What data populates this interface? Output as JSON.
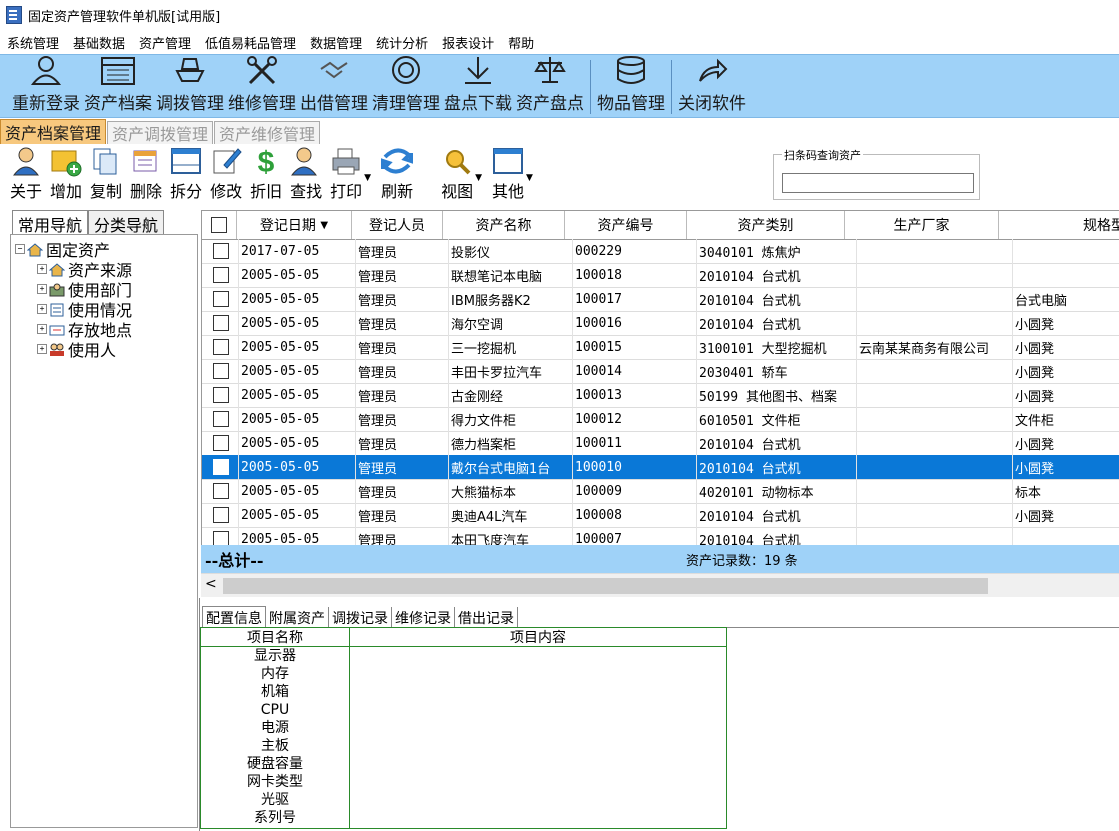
{
  "window": {
    "title": "固定资产管理软件单机版[试用版]"
  },
  "menu": [
    "系统管理",
    "基础数据",
    "资产管理",
    "低值易耗品管理",
    "数据管理",
    "统计分析",
    "报表设计",
    "帮助"
  ],
  "ribbon": [
    {
      "label": "重新登录",
      "icon": "user-icon"
    },
    {
      "label": "资产档案",
      "icon": "table-icon"
    },
    {
      "label": "调拨管理",
      "icon": "ship-icon"
    },
    {
      "label": "维修管理",
      "icon": "tools-icon"
    },
    {
      "label": "出借管理",
      "icon": "handshake-icon"
    },
    {
      "label": "清理管理",
      "icon": "clean-icon"
    },
    {
      "label": "盘点下载",
      "icon": "download-icon"
    },
    {
      "label": "资产盘点",
      "icon": "scale-icon"
    },
    {
      "label": "物品管理",
      "icon": "database-icon"
    },
    {
      "label": "关闭软件",
      "icon": "share-icon"
    }
  ],
  "module_tabs": [
    {
      "label": "资产档案管理",
      "active": true
    },
    {
      "label": "资产调拨管理",
      "active": false
    },
    {
      "label": "资产维修管理",
      "active": false
    }
  ],
  "toolbar": [
    {
      "label": "关于",
      "icon": "person-icon"
    },
    {
      "label": "增加",
      "icon": "add-folder-icon"
    },
    {
      "label": "复制",
      "icon": "copy-icon"
    },
    {
      "label": "删除",
      "icon": "delete-icon"
    },
    {
      "label": "拆分",
      "icon": "split-icon"
    },
    {
      "label": "修改",
      "icon": "edit-icon"
    },
    {
      "label": "折旧",
      "icon": "dollar-icon"
    },
    {
      "label": "查找",
      "icon": "find-person-icon"
    },
    {
      "label": "打印",
      "icon": "printer-icon"
    },
    {
      "label": "刷新",
      "icon": "refresh-icon"
    },
    {
      "label": "视图",
      "icon": "view-icon"
    },
    {
      "label": "其他",
      "icon": "other-icon"
    }
  ],
  "scan": {
    "legend": "扫条码查询资产",
    "value": ""
  },
  "nav_tabs": [
    "常用导航",
    "分类导航"
  ],
  "tree": {
    "root": "固定资产",
    "children": [
      "资产来源",
      "使用部门",
      "使用情况",
      "存放地点",
      "使用人"
    ]
  },
  "grid": {
    "columns": [
      "登记日期",
      "登记人员",
      "资产名称",
      "资产编号",
      "资产类别",
      "生产厂家",
      "规格型号"
    ],
    "sort_indicator": "▼",
    "rows": [
      [
        "2017-07-05",
        "管理员",
        "投影仪",
        "000229",
        "3040101 炼焦炉",
        "",
        ""
      ],
      [
        "2005-05-05",
        "管理员",
        "联想笔记本电脑",
        "100018",
        "2010104 台式机",
        "",
        ""
      ],
      [
        "2005-05-05",
        "管理员",
        "IBM服务器K2",
        "100017",
        "2010104 台式机",
        "",
        "台式电脑"
      ],
      [
        "2005-05-05",
        "管理员",
        "海尔空调",
        "100016",
        "2010104 台式机",
        "",
        "小圆凳"
      ],
      [
        "2005-05-05",
        "管理员",
        "三一挖掘机",
        "100015",
        "3100101 大型挖掘机",
        "云南某某商务有限公司",
        "小圆凳"
      ],
      [
        "2005-05-05",
        "管理员",
        "丰田卡罗拉汽车",
        "100014",
        "2030401 轿车",
        "",
        "小圆凳"
      ],
      [
        "2005-05-05",
        "管理员",
        "古金刚经",
        "100013",
        "50199 其他图书、档案",
        "",
        "小圆凳"
      ],
      [
        "2005-05-05",
        "管理员",
        "得力文件柜",
        "100012",
        "6010501 文件柜",
        "",
        "文件柜"
      ],
      [
        "2005-05-05",
        "管理员",
        "德力档案柜",
        "100011",
        "2010104 台式机",
        "",
        "小圆凳"
      ],
      [
        "2005-05-05",
        "管理员",
        "戴尔台式电脑1台",
        "100010",
        "2010104 台式机",
        "",
        "小圆凳"
      ],
      [
        "2005-05-05",
        "管理员",
        "大熊猫标本",
        "100009",
        "4020101 动物标本",
        "",
        "标本"
      ],
      [
        "2005-05-05",
        "管理员",
        "奥迪A4L汽车",
        "100008",
        "2010104 台式机",
        "",
        "小圆凳"
      ],
      [
        "2005-05-05",
        "管理员",
        "本田飞度汽车",
        "100007",
        "2010104 台式机",
        "",
        ""
      ]
    ],
    "selected_row": 9,
    "total_label": "--总计--",
    "count_text": "资产记录数：19 条"
  },
  "bottom_tabs": [
    "配置信息",
    "附属资产",
    "调拨记录",
    "维修记录",
    "借出记录"
  ],
  "detail": {
    "col1": "项目名称",
    "col2": "项目内容",
    "items": [
      "显示器",
      "内存",
      "机箱",
      "CPU",
      "电源",
      "主板",
      "硬盘容量",
      "网卡类型",
      "光驱",
      "系列号"
    ]
  },
  "colors": {
    "ribbon_bg": "#9fd2f8",
    "active_tab": "#f7c87e",
    "selection": "#0a78d7"
  }
}
